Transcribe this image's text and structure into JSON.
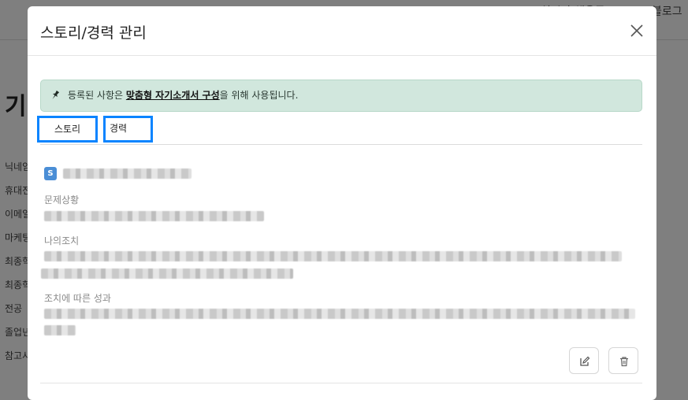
{
  "background": {
    "nav_right_1": "실시간 채용공",
    "nav_right_2": "블로그",
    "title": "기",
    "side_labels": [
      "닉네임",
      "휴대전",
      "이메일",
      "마케팅",
      "최종학",
      "최종학",
      "전공",
      "졸업년",
      "참고사"
    ]
  },
  "modal": {
    "title": "스토리/경력 관리",
    "notice": {
      "prefix": "등록된 사항은 ",
      "bold": "맞춤형 자기소개서 구성",
      "suffix": "을 위해 사용됩니다."
    },
    "tabs": [
      {
        "label": "스토리"
      },
      {
        "label": "경력"
      }
    ],
    "story": {
      "badge": "S",
      "fields": [
        {
          "label": "문제상황"
        },
        {
          "label": "나의조치"
        },
        {
          "label": "조치에 따른 성과"
        }
      ]
    }
  },
  "colors": {
    "accent": "#0a84ff",
    "notice_bg": "#d1e7dd",
    "badge": "#4a8ed6",
    "overlay": "#7f7f7f"
  },
  "icons": {
    "close": "close-icon",
    "pin": "pin-icon",
    "edit": "edit-icon",
    "delete": "trash-icon"
  }
}
